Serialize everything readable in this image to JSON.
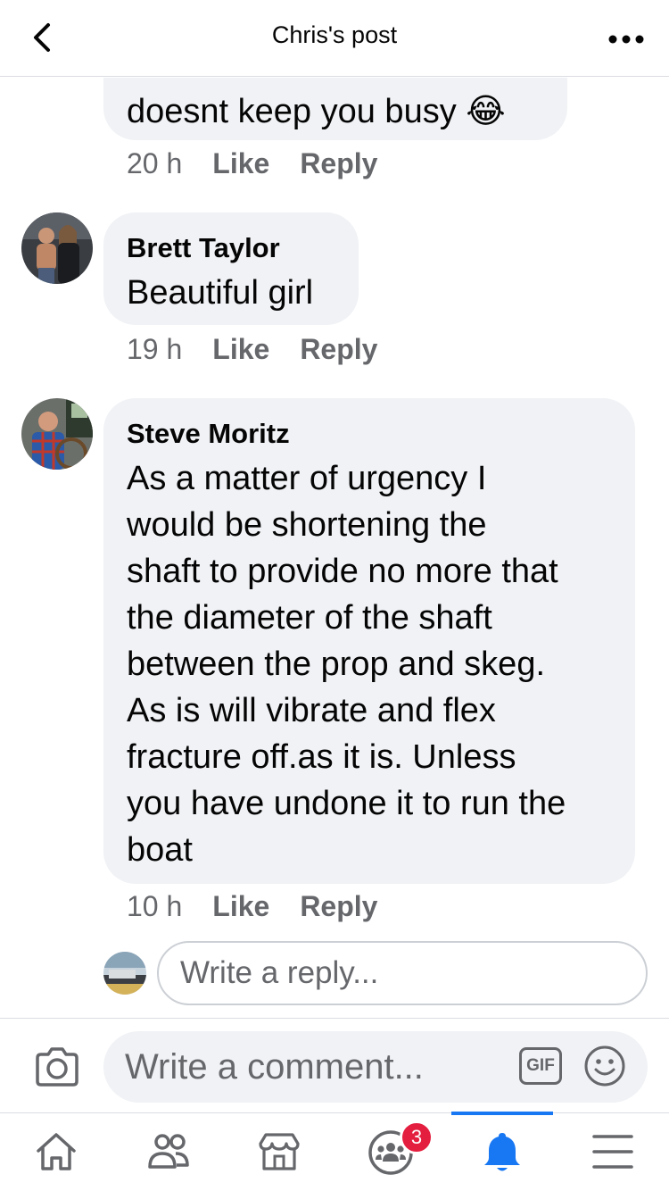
{
  "header": {
    "title": "Chris's post"
  },
  "comments": [
    {
      "text": "doesnt keep you busy 😂",
      "time": "20 h",
      "like": "Like",
      "reply": "Reply"
    },
    {
      "author": "Brett Taylor",
      "text": "Beautiful girl",
      "time": "19 h",
      "like": "Like",
      "reply": "Reply"
    },
    {
      "author": "Steve Moritz",
      "lines": [
        "As a matter of urgency I",
        "would be shortening the",
        "shaft to provide no more that",
        "the diameter of the shaft",
        "between the prop and skeg.",
        "As is will vibrate and flex",
        "fracture off.as it is. Unless",
        "you have undone it to run the",
        "boat"
      ],
      "time": "10 h",
      "like": "Like",
      "reply": "Reply"
    }
  ],
  "reply_input": {
    "placeholder": "Write a reply..."
  },
  "composer": {
    "placeholder": "Write a comment...",
    "gif_label": "GIF"
  },
  "nav": {
    "groups_badge": "3"
  },
  "colors": {
    "accent": "#1877f2",
    "badge": "#e41e3f",
    "bubble": "#f0f2f5",
    "secondary_text": "#65676b"
  },
  "icons": [
    "back-arrow-icon",
    "more-icon",
    "camera-icon",
    "gif-icon",
    "smiley-icon",
    "home-icon",
    "friends-icon",
    "marketplace-icon",
    "groups-icon",
    "bell-icon",
    "menu-icon"
  ]
}
